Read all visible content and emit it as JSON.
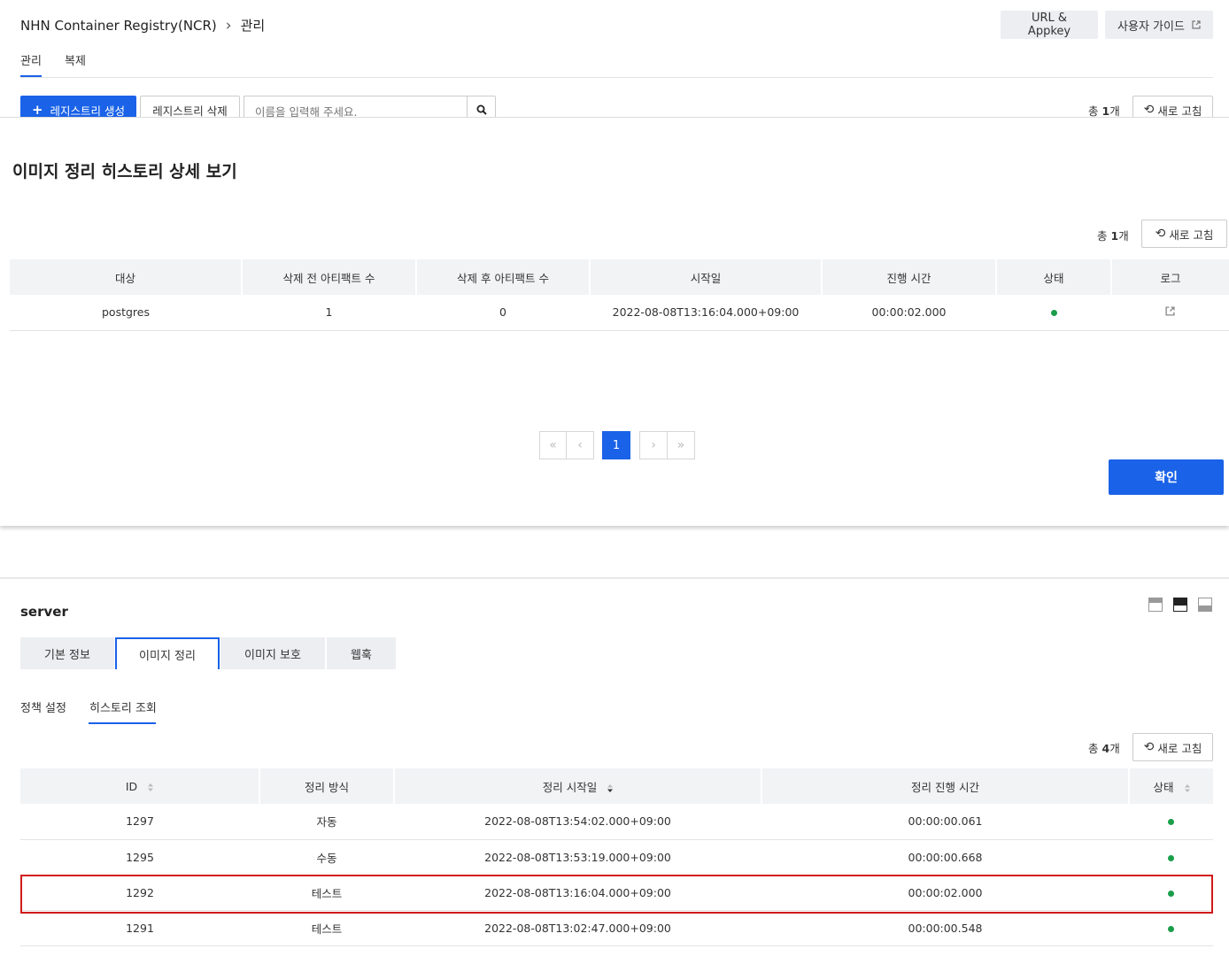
{
  "header": {
    "service": "NHN Container Registry(NCR)",
    "breadcrumb_sep": "›",
    "current": "관리",
    "url_appkey": "URL & Appkey",
    "user_guide": "사용자 가이드"
  },
  "top_tabs": [
    "관리",
    "복제"
  ],
  "toolbar": {
    "create_label": "레지스트리 생성",
    "delete_label": "레지스트리 삭제",
    "search_placeholder": "이름을 입력해 주세요.",
    "total_prefix": "총 ",
    "total_count": "1",
    "total_suffix": "개",
    "refresh_label": "새로 고침"
  },
  "modal": {
    "title": "이미지 정리 히스토리 상세 보기",
    "total_prefix": "총 ",
    "total_count": "1",
    "total_suffix": "개",
    "refresh_label": "새로 고침",
    "columns": [
      "대상",
      "삭제 전 아티팩트 수",
      "삭제 후 아티팩트 수",
      "시작일",
      "진행 시간",
      "상태",
      "로그"
    ],
    "rows": [
      {
        "target": "postgres",
        "before": "1",
        "after": "0",
        "start": "2022-08-08T13:16:04.000+09:00",
        "duration": "00:00:02.000",
        "status": "success"
      }
    ],
    "pagination": {
      "first": "«",
      "prev": "‹",
      "current": "1",
      "next": "›",
      "last": "»"
    },
    "confirm_label": "확인"
  },
  "panel": {
    "title": "server",
    "tabs": [
      "기본 정보",
      "이미지 정리",
      "이미지 보호",
      "웹훅"
    ],
    "subtabs": [
      "정책 설정",
      "히스토리 조회"
    ],
    "total_prefix": "총 ",
    "total_count": "4",
    "total_suffix": "개",
    "refresh_label": "새로 고침",
    "columns": [
      "ID",
      "정리 방식",
      "정리 시작일",
      "정리 진행 시간",
      "상태"
    ],
    "rows": [
      {
        "id": "1297",
        "method": "자동",
        "start": "2022-08-08T13:54:02.000+09:00",
        "duration": "00:00:00.061",
        "status": "success"
      },
      {
        "id": "1295",
        "method": "수동",
        "start": "2022-08-08T13:53:19.000+09:00",
        "duration": "00:00:00.668",
        "status": "success"
      },
      {
        "id": "1292",
        "method": "테스트",
        "start": "2022-08-08T13:16:04.000+09:00",
        "duration": "00:00:02.000",
        "status": "success"
      },
      {
        "id": "1291",
        "method": "테스트",
        "start": "2022-08-08T13:02:47.000+09:00",
        "duration": "00:00:00.548",
        "status": "success"
      }
    ],
    "highlighted_row": "1292"
  },
  "colors": {
    "accent": "#1a62e8",
    "success": "#1a9e4a",
    "highlight": "#d11a1a"
  }
}
